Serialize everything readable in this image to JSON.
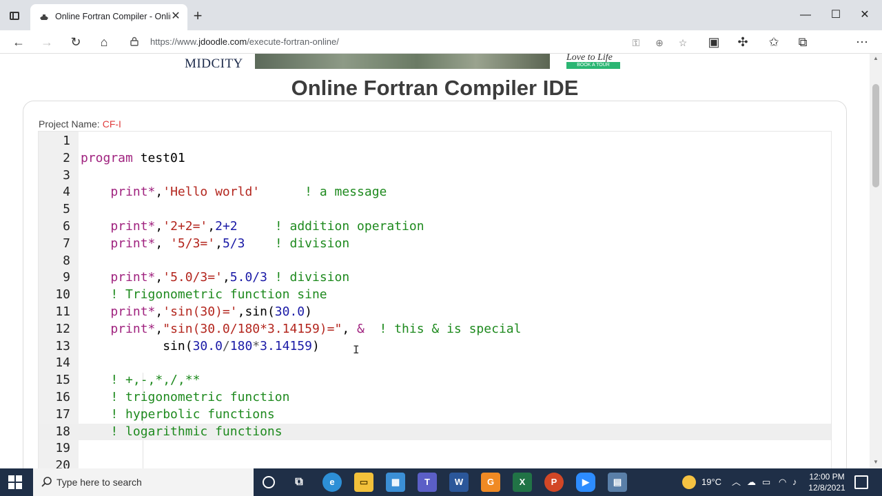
{
  "browser": {
    "tab_title": "Online Fortran Compiler - Online",
    "tab_close": "✕",
    "new_tab": "+",
    "window": {
      "minimize": "—",
      "maximize": "☐",
      "close": "✕"
    },
    "url_prefix": "https://www.",
    "url_domain": "jdoodle.com",
    "url_path": "/execute-fortran-online/"
  },
  "ad": {
    "brand": "MIDCITY",
    "tagline": "Love to Life",
    "cta": "BOOK A TOUR"
  },
  "page": {
    "title": "Online Fortran Compiler IDE",
    "project_label": "Project Name:",
    "project_name": "CF-I"
  },
  "editor": {
    "active_line": 18,
    "lines": [
      {
        "n": "1",
        "tokens": []
      },
      {
        "n": "2",
        "tokens": [
          [
            "k",
            "program"
          ],
          [
            "p",
            " test01"
          ]
        ]
      },
      {
        "n": "3",
        "tokens": []
      },
      {
        "n": "4",
        "tokens": [
          [
            "p",
            "    "
          ],
          [
            "k",
            "print*"
          ],
          [
            "p",
            ","
          ],
          [
            "s",
            "'Hello world'"
          ],
          [
            "p",
            "      "
          ],
          [
            "c",
            "! a message"
          ]
        ]
      },
      {
        "n": "5",
        "tokens": []
      },
      {
        "n": "6",
        "tokens": [
          [
            "p",
            "    "
          ],
          [
            "k",
            "print*"
          ],
          [
            "p",
            ","
          ],
          [
            "s",
            "'2+2='"
          ],
          [
            "p",
            ","
          ],
          [
            "n",
            "2+2"
          ],
          [
            "p",
            "     "
          ],
          [
            "c",
            "! addition operation"
          ]
        ]
      },
      {
        "n": "7",
        "tokens": [
          [
            "p",
            "    "
          ],
          [
            "k",
            "print*"
          ],
          [
            "p",
            ", "
          ],
          [
            "s",
            "'5/3='"
          ],
          [
            "p",
            ","
          ],
          [
            "n",
            "5/3"
          ],
          [
            "p",
            "    "
          ],
          [
            "c",
            "! division"
          ]
        ]
      },
      {
        "n": "8",
        "tokens": []
      },
      {
        "n": "9",
        "tokens": [
          [
            "p",
            "    "
          ],
          [
            "k",
            "print*"
          ],
          [
            "p",
            ","
          ],
          [
            "s",
            "'5.0/3='"
          ],
          [
            "p",
            ","
          ],
          [
            "n",
            "5.0/3"
          ],
          [
            "p",
            " "
          ],
          [
            "c",
            "! division"
          ]
        ]
      },
      {
        "n": "10",
        "tokens": [
          [
            "p",
            "    "
          ],
          [
            "c",
            "! Trigonometric function sine"
          ]
        ]
      },
      {
        "n": "11",
        "tokens": [
          [
            "p",
            "    "
          ],
          [
            "k",
            "print*"
          ],
          [
            "p",
            ","
          ],
          [
            "s",
            "'sin(30)='"
          ],
          [
            "p",
            ",sin("
          ],
          [
            "n",
            "30.0"
          ],
          [
            "p",
            ")"
          ]
        ]
      },
      {
        "n": "12",
        "tokens": [
          [
            "p",
            "    "
          ],
          [
            "k",
            "print*"
          ],
          [
            "p",
            ","
          ],
          [
            "s",
            "\"sin(30.0/180*3.14159)=\""
          ],
          [
            "p",
            ", "
          ],
          [
            "k",
            "&"
          ],
          [
            "p",
            "  "
          ],
          [
            "c",
            "! this & is special"
          ]
        ]
      },
      {
        "n": "13",
        "tokens": [
          [
            "p",
            "           sin("
          ],
          [
            "n",
            "30.0"
          ],
          [
            "o",
            "/"
          ],
          [
            "n",
            "180"
          ],
          [
            "o",
            "*"
          ],
          [
            "n",
            "3.14159"
          ],
          [
            "p",
            ")"
          ]
        ]
      },
      {
        "n": "14",
        "tokens": []
      },
      {
        "n": "15",
        "tokens": [
          [
            "p",
            "    "
          ],
          [
            "c",
            "! +,-,*,/,**"
          ]
        ]
      },
      {
        "n": "16",
        "tokens": [
          [
            "p",
            "    "
          ],
          [
            "c",
            "! trigonometric function"
          ]
        ]
      },
      {
        "n": "17",
        "tokens": [
          [
            "p",
            "    "
          ],
          [
            "c",
            "! hyperbolic functions"
          ]
        ]
      },
      {
        "n": "18",
        "tokens": [
          [
            "p",
            "    "
          ],
          [
            "c",
            "! logarithmic functions"
          ]
        ]
      },
      {
        "n": "19",
        "tokens": []
      },
      {
        "n": "20",
        "tokens": []
      }
    ]
  },
  "taskbar": {
    "search_placeholder": "Type here to search",
    "weather": "19°C",
    "time": "12:00 PM",
    "date": "12/8/2021",
    "apps": [
      "cortana-circle-icon",
      "task-view-icon",
      "edge-icon",
      "file-explorer-icon",
      "store-icon",
      "teams-icon",
      "word-icon",
      "g-app-icon",
      "excel-icon",
      "powerpoint-icon",
      "zoom-icon",
      "remote-desktop-icon"
    ]
  },
  "colors": {
    "keyword": "#a0237f",
    "string": "#b3261e",
    "number": "#1a1aa6",
    "comment": "#1e8a1e",
    "taskbar": "#1f2f47"
  }
}
